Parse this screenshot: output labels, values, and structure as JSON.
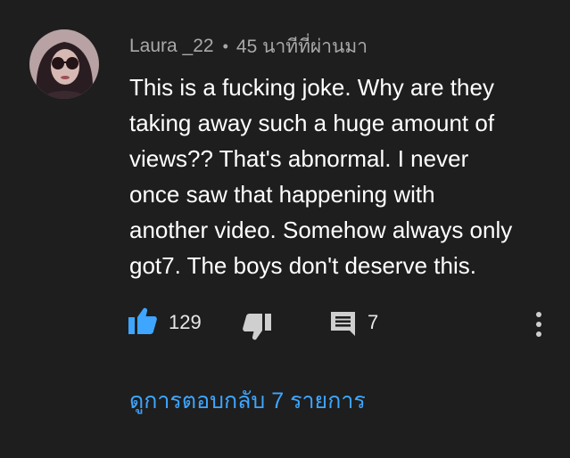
{
  "comment": {
    "author": "Laura _22",
    "separator": "•",
    "time_ago": "45 นาทีที่ผ่านมา",
    "text_lines": [
      "This is a fucking joke. Why are they",
      "taking away such a huge amount of",
      "views?? That's abnormal. I never",
      "once saw that happening with",
      "another video. Somehow always only",
      "got7. The boys don't deserve this."
    ],
    "like_count": "129",
    "reply_count": "7",
    "view_replies_label": "ดูการตอบกลับ 7 รายการ"
  },
  "icons": {
    "avatar": "avatar-image",
    "like": "thumbs-up-icon",
    "dislike": "thumbs-down-icon",
    "reply": "comment-icon",
    "more": "more-vertical-icon"
  },
  "colors": {
    "background": "#1e1e1e",
    "accent": "#3ea6ff",
    "text": "#ffffff",
    "meta": "#a9a9a9"
  }
}
